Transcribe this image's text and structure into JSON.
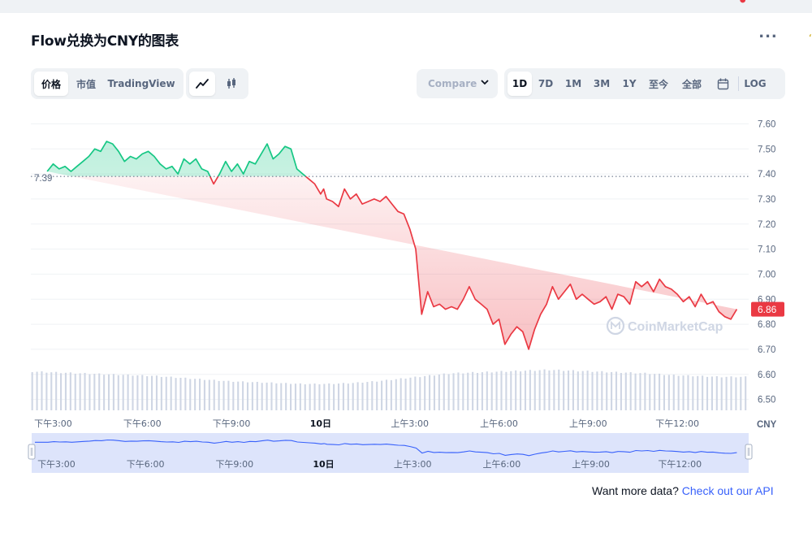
{
  "title": "Flow兑换为CNY的图表",
  "more_label": "...",
  "view_tabs": [
    {
      "label": "价格",
      "active": true
    },
    {
      "label": "市值",
      "active": false
    },
    {
      "label": "TradingView",
      "active": false
    }
  ],
  "chart_type_icons": [
    "line-chart-icon",
    "candlestick-icon"
  ],
  "compare_label": "Compare",
  "range_tabs": [
    {
      "label": "1D",
      "active": true
    },
    {
      "label": "7D",
      "active": false
    },
    {
      "label": "1M",
      "active": false
    },
    {
      "label": "3M",
      "active": false
    },
    {
      "label": "1Y",
      "active": false
    },
    {
      "label": "至今",
      "active": false
    },
    {
      "label": "全部",
      "active": false
    }
  ],
  "calendar_icon": "calendar-icon",
  "log_label": "LOG",
  "footer": {
    "text": "Want more data?",
    "link": "Check out our API"
  },
  "watermark": "CoinMarketCap",
  "colors": {
    "up": "#16c784",
    "down": "#ea3943",
    "accent": "#3861fb"
  },
  "chart_data": {
    "type": "line",
    "currency": "CNY",
    "open_price": 7.39,
    "open_price_label": "7.39",
    "last_price": 6.86,
    "last_price_label": "6.86",
    "ylim": [
      6.45,
      7.65
    ],
    "yticks": [
      "7.60",
      "7.50",
      "7.40",
      "7.30",
      "7.20",
      "7.10",
      "7.00",
      "6.90",
      "6.80",
      "6.70",
      "6.60",
      "6.50"
    ],
    "xtick_labels": [
      "下午3:00",
      "下午6:00",
      "下午9:00",
      "10日",
      "上午3:00",
      "上午6:00",
      "上午9:00",
      "下午12:00"
    ],
    "xtick_hours": [
      0,
      3,
      6,
      9,
      12,
      15,
      18,
      21
    ],
    "xlim_hours": [
      -0.75,
      23.4
    ],
    "ylabel_unit": "CNY",
    "series": [
      {
        "hours": [
          -0.2,
          0.0,
          0.2,
          0.4,
          0.6,
          0.8,
          1.0,
          1.2,
          1.4,
          1.6,
          1.8,
          2.0,
          2.2,
          2.4,
          2.6,
          2.8,
          3.0,
          3.2,
          3.4,
          3.6,
          3.8,
          4.0,
          4.2,
          4.4,
          4.6,
          4.8,
          5.0,
          5.2,
          5.4,
          5.6,
          5.8,
          6.0,
          6.2,
          6.4,
          6.6,
          6.8,
          7.0,
          7.2,
          7.4,
          7.6,
          7.8,
          8.0,
          8.2,
          8.4,
          8.6,
          8.8,
          9.0,
          9.1,
          9.2,
          9.4,
          9.6,
          9.8,
          10.0,
          10.2,
          10.4,
          10.6,
          10.8,
          11.0,
          11.2,
          11.4,
          11.6,
          11.8,
          12.0,
          12.2,
          12.4,
          12.6,
          12.8,
          13.0,
          13.2,
          13.4,
          13.6,
          13.8,
          14.0,
          14.2,
          14.4,
          14.6,
          14.8,
          15.0,
          15.2,
          15.4,
          15.6,
          15.8,
          16.0,
          16.2,
          16.4,
          16.6,
          16.8,
          17.0,
          17.2,
          17.4,
          17.6,
          17.8,
          18.0,
          18.2,
          18.4,
          18.6,
          18.8,
          19.0,
          19.2,
          19.4,
          19.6,
          19.8,
          20.0,
          20.2,
          20.4,
          20.6,
          20.8,
          21.0,
          21.2,
          21.4,
          21.6,
          21.8,
          22.0,
          22.2,
          22.4,
          22.6,
          22.8,
          23.0,
          23.2
        ],
        "values": [
          7.41,
          7.44,
          7.42,
          7.43,
          7.41,
          7.43,
          7.45,
          7.47,
          7.5,
          7.49,
          7.53,
          7.52,
          7.49,
          7.45,
          7.47,
          7.46,
          7.48,
          7.49,
          7.47,
          7.44,
          7.42,
          7.43,
          7.4,
          7.46,
          7.44,
          7.46,
          7.42,
          7.41,
          7.36,
          7.4,
          7.45,
          7.41,
          7.44,
          7.4,
          7.45,
          7.44,
          7.48,
          7.52,
          7.46,
          7.48,
          7.51,
          7.5,
          7.42,
          7.4,
          7.38,
          7.36,
          7.32,
          7.34,
          7.3,
          7.29,
          7.27,
          7.34,
          7.3,
          7.32,
          7.28,
          7.29,
          7.3,
          7.29,
          7.31,
          7.28,
          7.25,
          7.24,
          7.18,
          7.1,
          6.84,
          6.93,
          6.87,
          6.88,
          6.86,
          6.87,
          6.86,
          6.9,
          6.95,
          6.9,
          6.88,
          6.86,
          6.8,
          6.82,
          6.72,
          6.76,
          6.79,
          6.77,
          6.7,
          6.78,
          6.84,
          6.88,
          6.95,
          6.9,
          6.93,
          6.96,
          6.9,
          6.92,
          6.9,
          6.88,
          6.89,
          6.91,
          6.86,
          6.92,
          6.91,
          6.88,
          6.97,
          6.95,
          6.97,
          6.93,
          6.98,
          6.95,
          6.94,
          6.92,
          6.89,
          6.91,
          6.87,
          6.92,
          6.88,
          6.89,
          6.85,
          6.83,
          6.82,
          6.86
        ]
      }
    ],
    "volume_hours": [
      -0.7,
      23.3
    ],
    "volume": [
      0.88,
      0.86,
      0.84,
      0.82,
      0.8,
      0.78,
      0.74,
      0.7,
      0.66,
      0.64,
      0.62,
      0.6,
      0.6,
      0.62,
      0.66,
      0.72,
      0.78,
      0.84,
      0.86,
      0.88,
      0.9,
      0.92,
      0.9,
      0.88,
      0.86,
      0.84,
      0.8,
      0.78,
      0.76,
      0.76
    ]
  }
}
